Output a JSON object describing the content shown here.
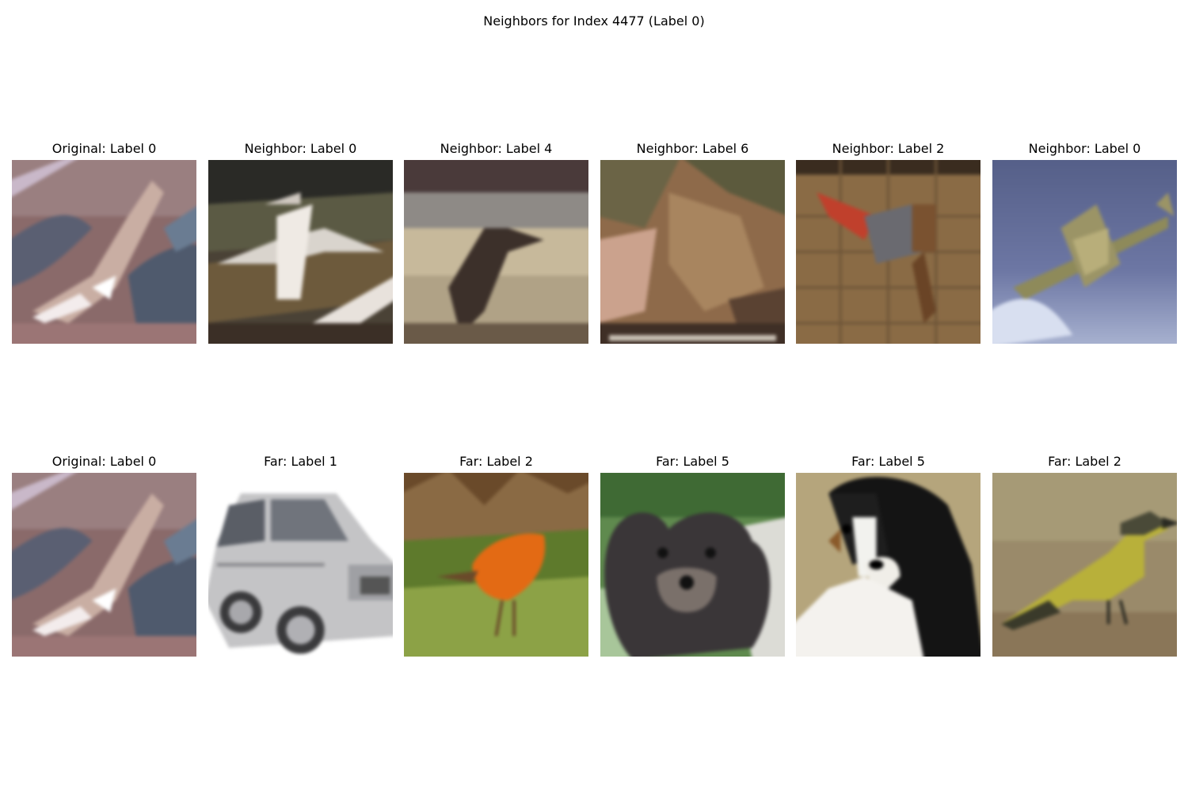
{
  "figure": {
    "title": "Neighbors for Index 4477 (Label 0)"
  },
  "rows": [
    {
      "panels": [
        {
          "title": "Original: Label 0",
          "image": "airplane-aerial-photo"
        },
        {
          "title": "Neighbor: Label 0",
          "image": "white-jet-over-ground-photo"
        },
        {
          "title": "Neighbor: Label 4",
          "image": "blurry-animal-photo"
        },
        {
          "title": "Neighbor: Label 6",
          "image": "frog-on-rocks-photo"
        },
        {
          "title": "Neighbor: Label 2",
          "image": "bird-on-wall-photo"
        },
        {
          "title": "Neighbor: Label 0",
          "image": "propeller-plane-in-sky-photo"
        }
      ]
    },
    {
      "panels": [
        {
          "title": "Original: Label 0",
          "image": "airplane-aerial-photo"
        },
        {
          "title": "Far: Label 1",
          "image": "silver-car-photo"
        },
        {
          "title": "Far: Label 2",
          "image": "orange-bird-on-grass-photo"
        },
        {
          "title": "Far: Label 5",
          "image": "black-dog-photo"
        },
        {
          "title": "Far: Label 5",
          "image": "bernese-dog-photo"
        },
        {
          "title": "Far: Label 2",
          "image": "yellow-bird-photo"
        }
      ]
    }
  ]
}
